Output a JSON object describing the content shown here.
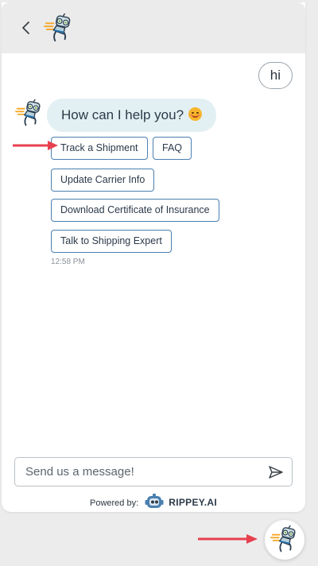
{
  "header": {
    "back_icon": "chevron-left-icon",
    "avatar_icon": "robot-mascot-icon"
  },
  "chat": {
    "user_message": "hi",
    "bot_message": "How can I help you?",
    "bot_emoji": "smiling-face-emoji",
    "quick_replies": [
      "Track a Shipment",
      "FAQ",
      "Update Carrier Info",
      "Download Certificate of Insurance",
      "Talk to Shipping Expert"
    ],
    "timestamp": "12:58 PM"
  },
  "composer": {
    "placeholder": "Send us a message!",
    "send_icon": "send-icon"
  },
  "footer": {
    "powered_label": "Powered by:",
    "brand": "RIPPEY.AI"
  },
  "colors": {
    "header_bg": "#ebebeb",
    "bot_bubble_bg": "#e3f0f3",
    "quick_reply_border": "#4a7fb0",
    "annotation_arrow": "#e8404f"
  }
}
